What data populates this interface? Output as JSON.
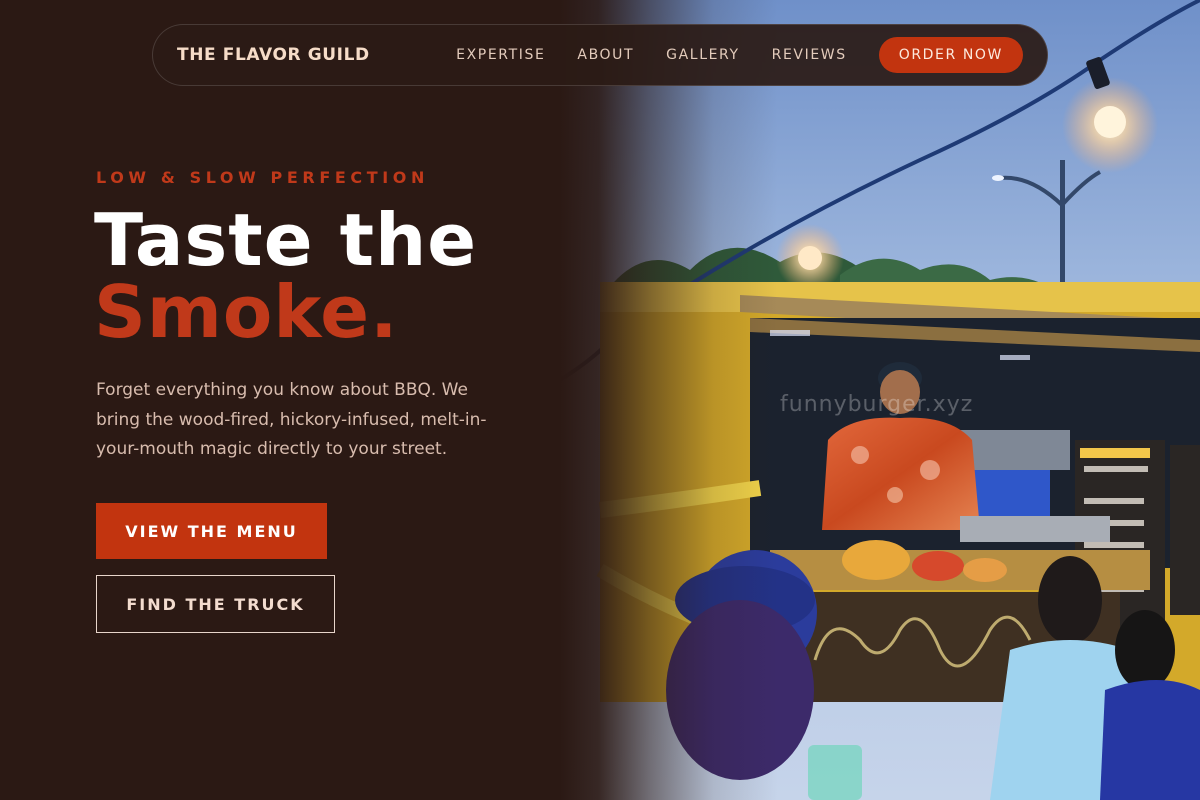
{
  "nav": {
    "brand": "THE FLAVOR GUILD",
    "links": [
      "EXPERTISE",
      "ABOUT",
      "GALLERY",
      "REVIEWS"
    ],
    "cta": "ORDER NOW"
  },
  "hero": {
    "eyebrow": "LOW & SLOW PERFECTION",
    "headline_line1": "Taste the",
    "headline_line2": "Smoke.",
    "lede": "Forget everything you know about BBQ. We bring the wood-fired, hickory-infused, melt-in-your-mouth magic directly to your street.",
    "primary_button": "VIEW THE MENU",
    "secondary_button": "FIND THE TRUCK"
  },
  "photo": {
    "watermark": "funnyburger.xyz"
  },
  "colors": {
    "background": "#2b1914",
    "accent": "#c2340f",
    "accent_text": "#c0391a"
  }
}
